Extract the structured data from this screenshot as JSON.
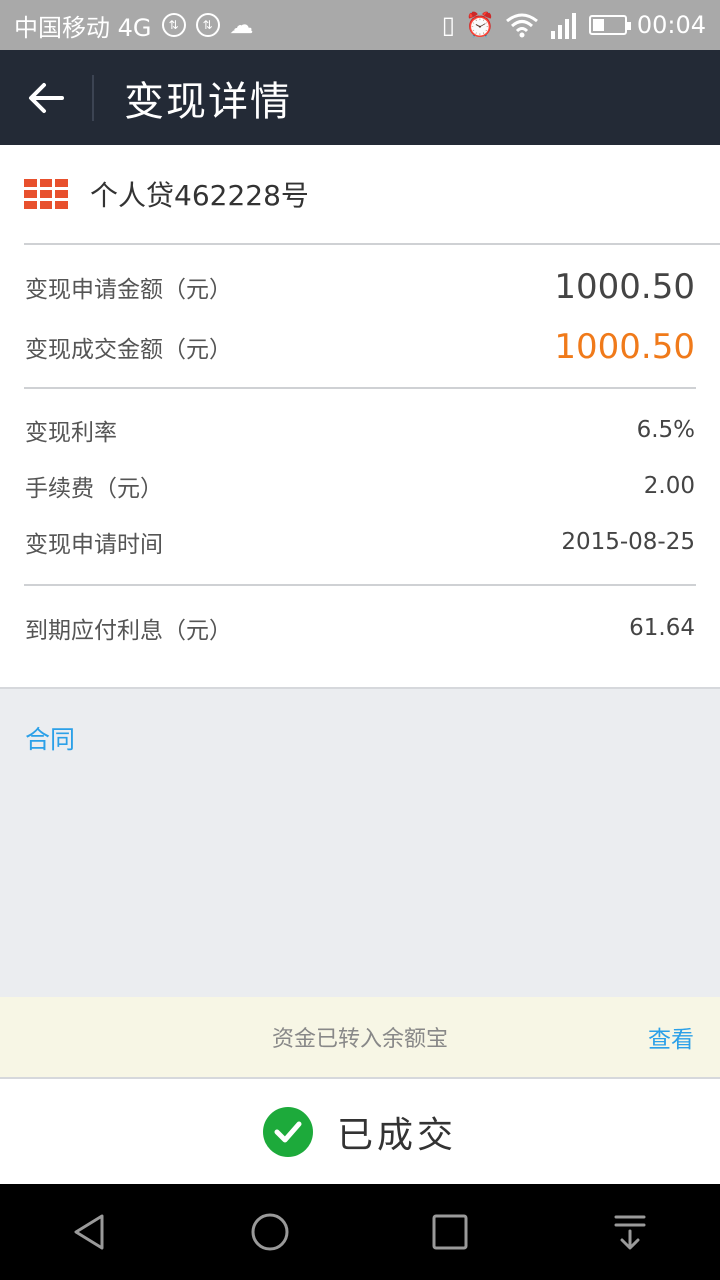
{
  "status_bar": {
    "carrier": "中国移动 4G",
    "time": "00:04",
    "battery_level": 0.35
  },
  "header": {
    "title": "变现详情",
    "back_icon": "arrow-left-icon"
  },
  "loan": {
    "name": "个人贷462228号",
    "logo_color": "#e8502d"
  },
  "amounts": [
    {
      "label": "变现申请金额（元）",
      "value": "1000.50"
    },
    {
      "label": "变现成交金额（元）",
      "value": "1000.50"
    }
  ],
  "details": [
    {
      "label": "变现利率",
      "value": "6.5%"
    },
    {
      "label": "手续费（元）",
      "value": "2.00"
    },
    {
      "label": "变现申请时间",
      "value": "2015-08-25"
    }
  ],
  "interest": {
    "label": "到期应付利息（元）",
    "value": "61.64"
  },
  "contract": {
    "label": "合同"
  },
  "notice": {
    "text": "资金已转入余额宝",
    "link": "查看"
  },
  "result": {
    "text": "已成交",
    "icon": "check-circle-icon",
    "color": "#1daa3b"
  },
  "colors": {
    "accent_orange": "#f07a1a",
    "link_blue": "#2ba0e8",
    "header_bg": "#232a36"
  }
}
